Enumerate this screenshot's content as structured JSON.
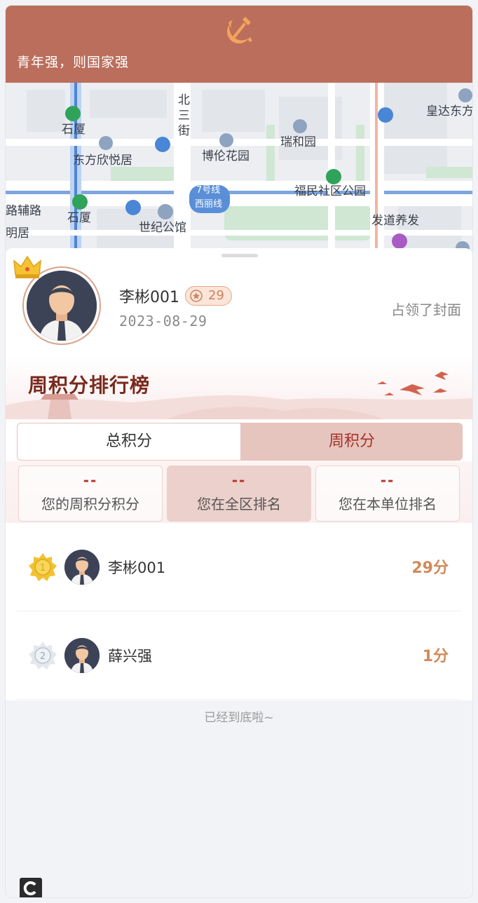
{
  "header": {
    "slogan": "青年强，则国家强"
  },
  "map": {
    "labels": [
      "石厦",
      "东方欣悦居",
      "博伦花园",
      "瑞和园",
      "皇达东方",
      "福民社区公园",
      "7号线",
      "西丽线",
      "世纪公馆",
      "发道养发",
      "路辅路",
      "石厦",
      "明居",
      "北",
      "三",
      "街"
    ]
  },
  "profile": {
    "name": "李彬001",
    "badge_score": "29",
    "date": "2023-08-29",
    "status": "占领了封面"
  },
  "leaderboard": {
    "title": "周积分排行榜",
    "tabs": [
      {
        "label": "总积分",
        "active": false
      },
      {
        "label": "周积分",
        "active": true
      }
    ],
    "stats": [
      {
        "value": "--",
        "label": "您的周积分积分"
      },
      {
        "value": "--",
        "label": "您在全区排名"
      },
      {
        "value": "--",
        "label": "您在本单位排名"
      }
    ],
    "rows": [
      {
        "rank": "1",
        "name": "李彬001",
        "score": "29分"
      },
      {
        "rank": "2",
        "name": "薛兴强",
        "score": "1分"
      }
    ],
    "end_text": "已经到底啦~"
  },
  "colors": {
    "header": "#bb6e5b",
    "accent": "#a53226",
    "score": "#d08b5a"
  }
}
